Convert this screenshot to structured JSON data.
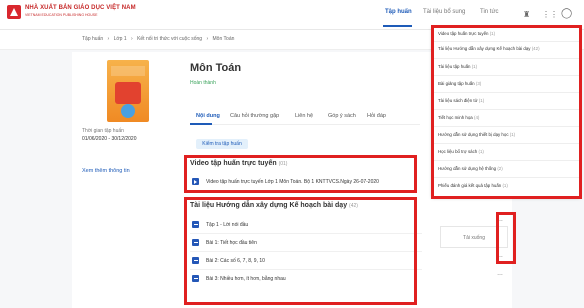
{
  "header": {
    "brand_name": "NHÀ XUẤT BẢN GIÁO DỤC VIỆT NAM",
    "brand_sub": "VIETNAM EDUCATION PUBLISHING HOUSE",
    "nav": [
      "Tập huấn",
      "Tài liệu bổ sung",
      "Tin tức"
    ]
  },
  "breadcrumb": [
    "Tập huấn",
    "›",
    "Lớp 1",
    "›",
    "Kết nối tri thức với cuộc sống",
    "›",
    "Môn Toán"
  ],
  "course": {
    "title": "Môn Toán",
    "status": "Hoàn thành",
    "period_label": "Thời gian tập huấn",
    "period_value": "01/06/2020 - 30/12/2020",
    "more_link": "Xem thêm thông tin"
  },
  "tabs": [
    "Nội dung",
    "Câu hỏi thường gặp",
    "Liên hệ",
    "Góp ý sách",
    "Hỏi đáp"
  ],
  "test_button": "Kiểm tra tập huấn",
  "video_section": {
    "title": "Video tập huấn trực tuyến",
    "count": "(01)",
    "items": [
      "Video tập huấn trực tuyến Lớp 1 Môn Toán. Bộ 1 KNTTVCS.Ngày 26-07-2020"
    ]
  },
  "doc_section": {
    "title": "Tài liệu Hướng dẫn xây dựng Kế hoạch bài dạy",
    "count": "(42)",
    "items": [
      "Tập 1 - Lời nói đầu",
      "Bài 1: Tiết học đầu tiên",
      "Bài 2: Các số 6, 7, 8, 9, 10",
      "Bài 3: Nhiều hơn, ít hơn, bằng nhau"
    ]
  },
  "download_popup": "Tải xuống",
  "dropdown": [
    {
      "label": "Video tập huấn trực tuyến",
      "count": "(1)"
    },
    {
      "label": "Tài liệu Hướng dẫn xây dựng Kế hoạch bài dạy",
      "count": "(42)"
    },
    {
      "label": "Tài liệu tập huấn",
      "count": "(1)"
    },
    {
      "label": "Bài giảng tập huấn",
      "count": "(3)"
    },
    {
      "label": "Tài liệu sách điện tử",
      "count": "(1)"
    },
    {
      "label": "Tiết học minh họa",
      "count": "(4)"
    },
    {
      "label": "Hướng dẫn sử dụng thiết bị dạy học",
      "count": "(1)"
    },
    {
      "label": "Học liệu bổ trợ sách",
      "count": "(1)"
    },
    {
      "label": "Hướng dẫn sử dụng hệ thống",
      "count": "(2)"
    },
    {
      "label": "Phiếu đánh giá kết quả tập huấn",
      "count": "(1)"
    }
  ],
  "colors": {
    "accent": "#1e5bb8",
    "highlight": "#e02020",
    "success": "#3aa35b"
  }
}
